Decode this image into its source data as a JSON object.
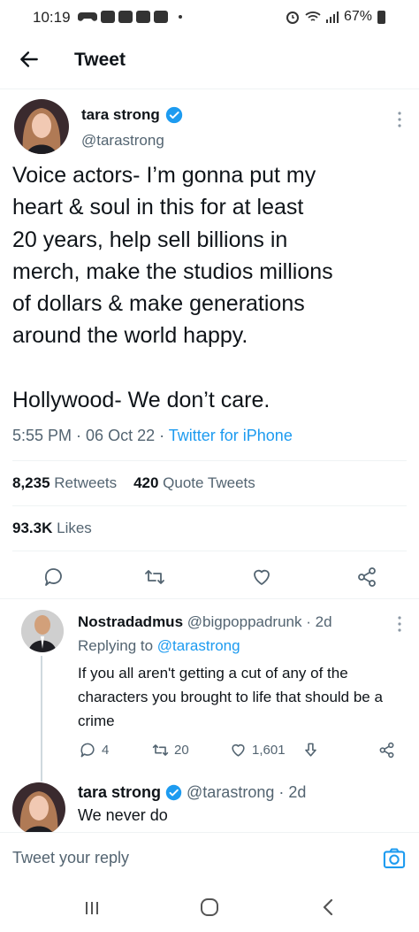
{
  "status_bar": {
    "time": "10:19",
    "battery": "67%"
  },
  "header": {
    "title": "Tweet"
  },
  "tweet": {
    "author_name": "tara strong",
    "author_handle": "@tarastrong",
    "text_lines": [
      "Voice actors- I’m gonna put my",
      "heart & soul in this for at least",
      "20 years, help sell billions in",
      "merch, make the studios millions",
      "of dollars & make generations",
      "around the world happy."
    ],
    "text_line2": "Hollywood- We don’t care.",
    "time": "5:55 PM",
    "date": "06 Oct 22",
    "source": "Twitter for iPhone",
    "retweets_count": "8,235",
    "retweets_label": "Retweets",
    "quotes_count": "420",
    "quotes_label": "Quote Tweets",
    "likes_count": "93.3K",
    "likes_label": "Likes"
  },
  "reply1": {
    "author_name": "Nostradadmus",
    "author_handle": "@bigpoppadrunk",
    "age": "2d",
    "replying_label": "Replying to",
    "replying_handle": "@tarastrong",
    "text": "If you all aren't getting a cut of any of the characters you brought to life that should be a crime",
    "reply_count": "4",
    "retweet_count": "20",
    "like_count": "1,601"
  },
  "reply2": {
    "author_name": "tara strong",
    "author_handle": "@tarastrong",
    "age": "2d",
    "text": "We never do"
  },
  "composer": {
    "placeholder": "Tweet your reply"
  },
  "colors": {
    "accent": "#1d9bf0",
    "text": "#0f1419",
    "muted": "#536471",
    "divider": "#eff3f4"
  }
}
